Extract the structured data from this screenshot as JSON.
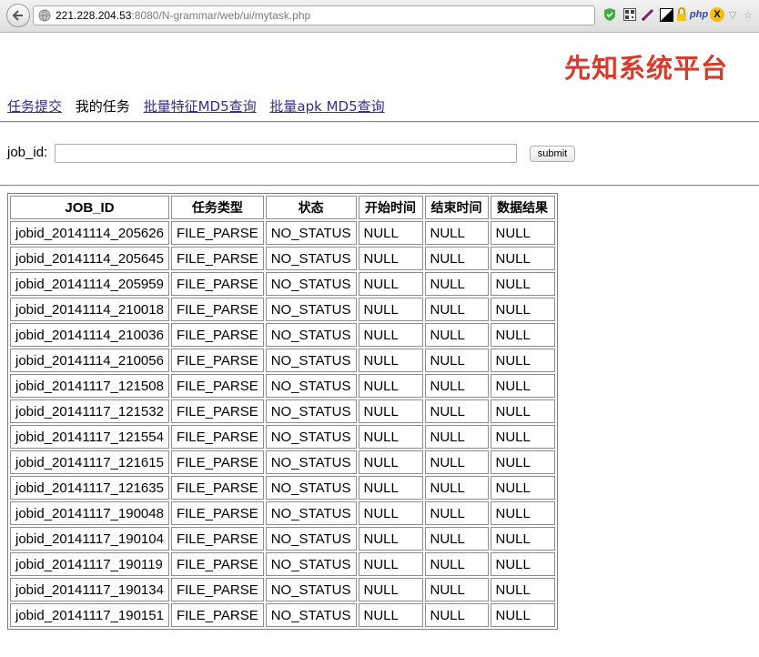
{
  "browser": {
    "url_host": "221.228.204.53",
    "url_rest": ":8080/N-grammar/web/ui/mytask.php",
    "extensions": [
      "shield-icon",
      "qr-code-icon",
      "brush-icon",
      "contrast-icon",
      "lock-icon",
      "php-icon",
      "x-icon",
      "dropdown-arrow-icon",
      "star-icon"
    ],
    "php_label": "php",
    "x_label": "X"
  },
  "site": {
    "title": "先知系统平台"
  },
  "nav": {
    "items": [
      {
        "label": "任务提交",
        "link": true
      },
      {
        "label": "我的任务",
        "link": false
      },
      {
        "label": "批量特征MD5查询",
        "link": true
      },
      {
        "label": "批量apk MD5查询",
        "link": true
      }
    ]
  },
  "form": {
    "label": "job_id:",
    "value": "",
    "submit_label": "submit"
  },
  "table": {
    "headers": [
      "JOB_ID",
      "任务类型",
      "状态",
      "开始时间",
      "结束时间",
      "数据结果"
    ],
    "rows": [
      [
        "jobid_20141114_205626",
        "FILE_PARSE",
        "NO_STATUS",
        "NULL",
        "NULL",
        "NULL"
      ],
      [
        "jobid_20141114_205645",
        "FILE_PARSE",
        "NO_STATUS",
        "NULL",
        "NULL",
        "NULL"
      ],
      [
        "jobid_20141114_205959",
        "FILE_PARSE",
        "NO_STATUS",
        "NULL",
        "NULL",
        "NULL"
      ],
      [
        "jobid_20141114_210018",
        "FILE_PARSE",
        "NO_STATUS",
        "NULL",
        "NULL",
        "NULL"
      ],
      [
        "jobid_20141114_210036",
        "FILE_PARSE",
        "NO_STATUS",
        "NULL",
        "NULL",
        "NULL"
      ],
      [
        "jobid_20141114_210056",
        "FILE_PARSE",
        "NO_STATUS",
        "NULL",
        "NULL",
        "NULL"
      ],
      [
        "jobid_20141117_121508",
        "FILE_PARSE",
        "NO_STATUS",
        "NULL",
        "NULL",
        "NULL"
      ],
      [
        "jobid_20141117_121532",
        "FILE_PARSE",
        "NO_STATUS",
        "NULL",
        "NULL",
        "NULL"
      ],
      [
        "jobid_20141117_121554",
        "FILE_PARSE",
        "NO_STATUS",
        "NULL",
        "NULL",
        "NULL"
      ],
      [
        "jobid_20141117_121615",
        "FILE_PARSE",
        "NO_STATUS",
        "NULL",
        "NULL",
        "NULL"
      ],
      [
        "jobid_20141117_121635",
        "FILE_PARSE",
        "NO_STATUS",
        "NULL",
        "NULL",
        "NULL"
      ],
      [
        "jobid_20141117_190048",
        "FILE_PARSE",
        "NO_STATUS",
        "NULL",
        "NULL",
        "NULL"
      ],
      [
        "jobid_20141117_190104",
        "FILE_PARSE",
        "NO_STATUS",
        "NULL",
        "NULL",
        "NULL"
      ],
      [
        "jobid_20141117_190119",
        "FILE_PARSE",
        "NO_STATUS",
        "NULL",
        "NULL",
        "NULL"
      ],
      [
        "jobid_20141117_190134",
        "FILE_PARSE",
        "NO_STATUS",
        "NULL",
        "NULL",
        "NULL"
      ],
      [
        "jobid_20141117_190151",
        "FILE_PARSE",
        "NO_STATUS",
        "NULL",
        "NULL",
        "NULL"
      ]
    ]
  },
  "colors": {
    "title": "#d83b2b",
    "link": "#3a2b8c"
  }
}
